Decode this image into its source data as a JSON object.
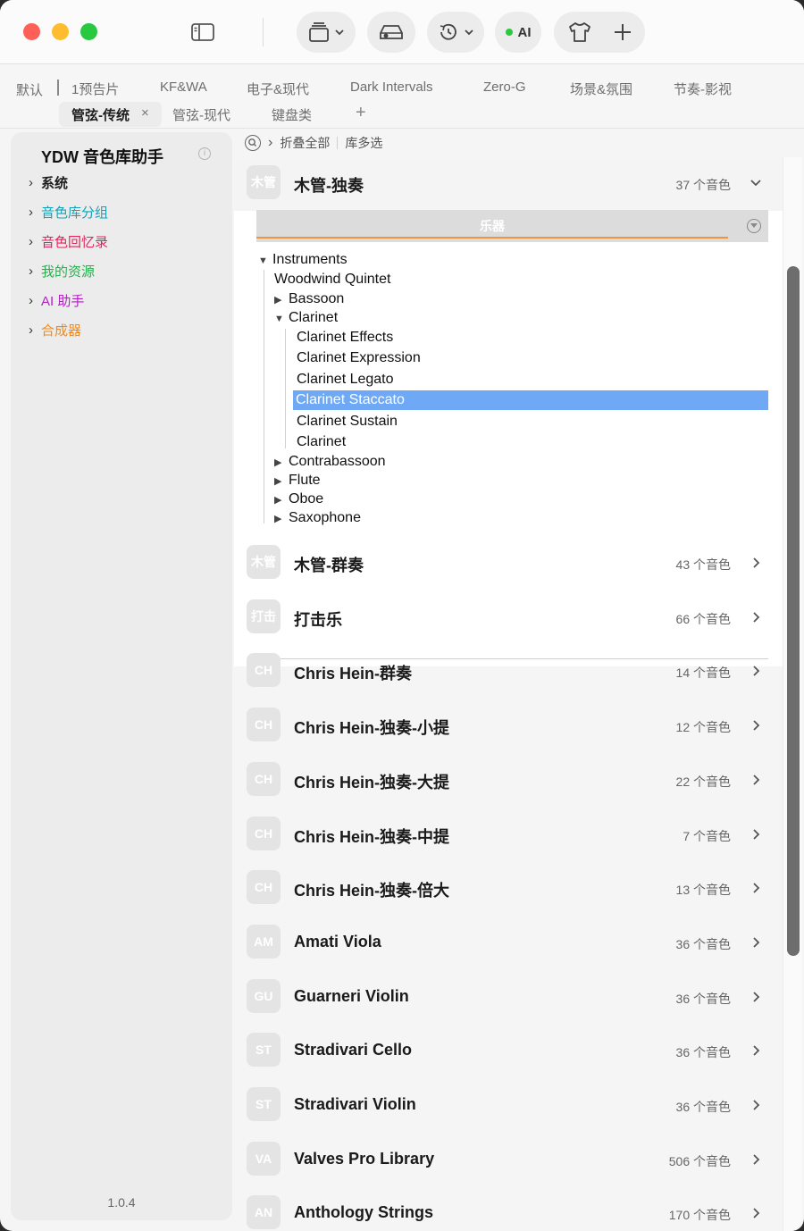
{
  "toolbar": {
    "ai_label": "AI"
  },
  "tabs": {
    "row1": [
      "默认",
      "1预告片",
      "KF&WA",
      "电子&现代",
      "Dark Intervals",
      "Zero-G",
      "场景&氛围",
      "节奏-影视"
    ],
    "row2": [
      "管弦-传统",
      "管弦-现代",
      "键盘类"
    ],
    "close_glyph": "×",
    "add_glyph": "+"
  },
  "sidebar": {
    "title": "YDW 音色库助手",
    "items": [
      {
        "label": "系统",
        "color": "#1d1d1f"
      },
      {
        "label": "音色库分组",
        "color": "#12a3b8"
      },
      {
        "label": "音色回忆录",
        "color": "#e0245e"
      },
      {
        "label": "我的资源",
        "color": "#22b14c"
      },
      {
        "label": "AI 助手",
        "color": "#b31fc4"
      },
      {
        "label": "合成器",
        "color": "#f08a1c"
      }
    ],
    "version": "1.0.4"
  },
  "crumbs": {
    "collapse_all": "折叠全部",
    "multi_select": "库多选"
  },
  "expanded": {
    "badge": "木管",
    "title": "木管-独奏",
    "count": "37 个音色",
    "instrument_header": "乐器",
    "tree": {
      "instruments": "Instruments",
      "woodwind_quintet": "Woodwind Quintet",
      "bassoon": "Bassoon",
      "clarinet": "Clarinet",
      "clarinet_children": [
        "Clarinet Effects",
        "Clarinet Expression",
        "Clarinet Legato",
        "Clarinet Staccato",
        "Clarinet Sustain",
        "Clarinet"
      ],
      "after": [
        "Contrabassoon",
        "Flute",
        "Oboe",
        "Saxophone"
      ]
    },
    "selected": "Clarinet Staccato"
  },
  "libraries": [
    {
      "badge": "木管",
      "title": "木管-群奏",
      "count": "43 个音色"
    },
    {
      "badge": "打击",
      "title": "打击乐",
      "count": "66 个音色"
    },
    {
      "badge": "CH",
      "title": "Chris Hein-群奏",
      "count": "14 个音色"
    },
    {
      "badge": "CH",
      "title": "Chris Hein-独奏-小提",
      "count": "12 个音色"
    },
    {
      "badge": "CH",
      "title": "Chris Hein-独奏-大提",
      "count": "22 个音色"
    },
    {
      "badge": "CH",
      "title": "Chris Hein-独奏-中提",
      "count": "7 个音色"
    },
    {
      "badge": "CH",
      "title": "Chris Hein-独奏-倍大",
      "count": "13 个音色"
    },
    {
      "badge": "AM",
      "title": "Amati Viola",
      "count": "36 个音色"
    },
    {
      "badge": "GU",
      "title": "Guarneri Violin",
      "count": "36 个音色"
    },
    {
      "badge": "ST",
      "title": "Stradivari Cello",
      "count": "36 个音色"
    },
    {
      "badge": "ST",
      "title": "Stradivari Violin",
      "count": "36 个音色"
    },
    {
      "badge": "VA",
      "title": "Valves Pro Library",
      "count": "506 个音色"
    },
    {
      "badge": "AN",
      "title": "Anthology Strings",
      "count": "170 个音色"
    }
  ]
}
